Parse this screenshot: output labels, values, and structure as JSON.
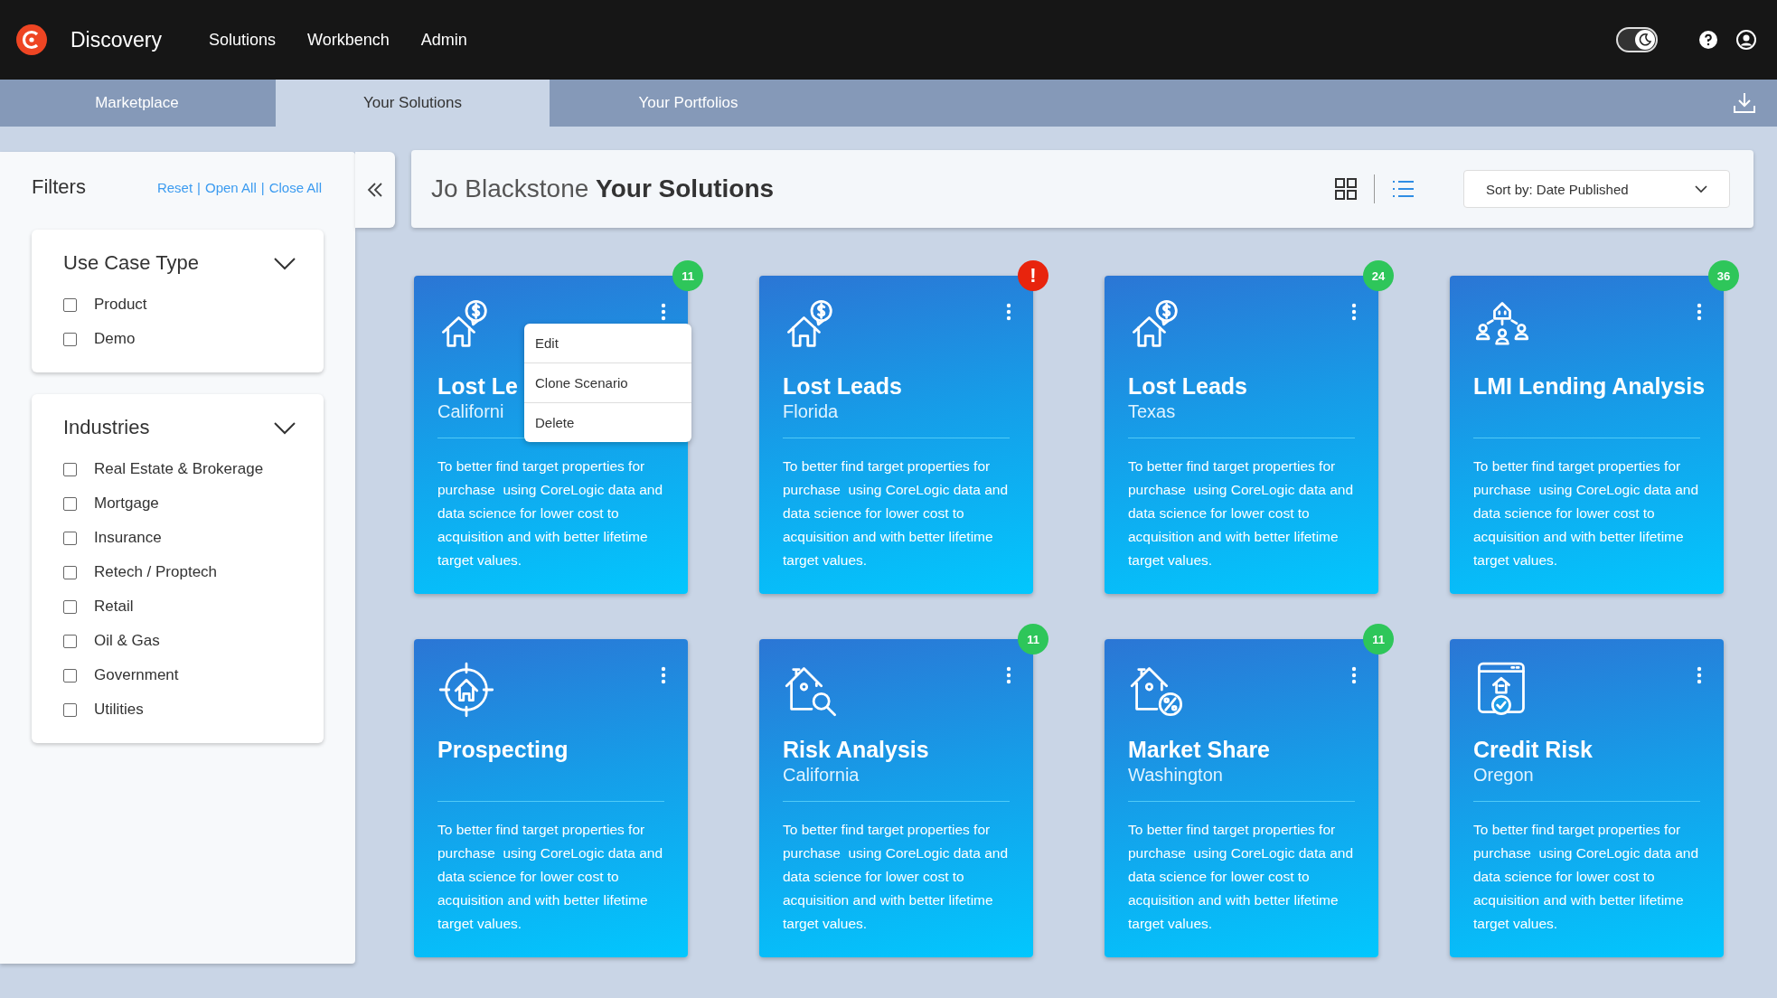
{
  "app": {
    "name": "Discovery"
  },
  "nav": [
    "Solutions",
    "Workbench",
    "Admin"
  ],
  "dark_mode_toggle": {
    "on": true
  },
  "tabs": [
    {
      "label": "Marketplace",
      "selected": false
    },
    {
      "label": "Your Solutions",
      "selected": true
    },
    {
      "label": "Your Portfolios",
      "selected": false
    }
  ],
  "filters": {
    "title": "Filters",
    "actions": [
      "Reset",
      "Open All",
      "Close All"
    ],
    "separator": "|",
    "sections": [
      {
        "title": "Use Case Type",
        "expanded": true,
        "options": [
          {
            "label": "Product",
            "checked": false
          },
          {
            "label": "Demo",
            "checked": false
          }
        ]
      },
      {
        "title": "Industries",
        "expanded": true,
        "options": [
          {
            "label": "Real Estate & Brokerage",
            "checked": false
          },
          {
            "label": "Mortgage",
            "checked": false
          },
          {
            "label": "Insurance",
            "checked": false
          },
          {
            "label": "Retech / Proptech",
            "checked": false
          },
          {
            "label": "Retail",
            "checked": false
          },
          {
            "label": "Oil & Gas",
            "checked": false
          },
          {
            "label": "Government",
            "checked": false
          },
          {
            "label": "Utilities",
            "checked": false
          }
        ]
      }
    ]
  },
  "header": {
    "owner": "Jo Blackstone",
    "title": "Your Solutions",
    "sort": {
      "value": "Sort by: Date Published"
    }
  },
  "cards": [
    {
      "kind": "house-dollar",
      "title": "Lost Le",
      "subtitle": "Californi",
      "description": "To better find target properties for purchase  using CoreLogic data and data science for lower cost to acquisition and with better lifetime target values.",
      "badge": {
        "kind": "count",
        "text": "11"
      },
      "menu": [
        "Edit",
        "Clone Scenario",
        "Delete"
      ]
    },
    {
      "kind": "house-dollar",
      "title": "Lost Leads",
      "subtitle": "Florida",
      "description": "To better find target properties for purchase  using CoreLogic data and data science for lower cost to acquisition and with better lifetime target values.",
      "badge": {
        "kind": "alert",
        "text": "!"
      }
    },
    {
      "kind": "house-dollar",
      "title": "Lost Leads",
      "subtitle": "Texas",
      "description": "To better find target properties for purchase  using CoreLogic data and data science for lower cost to acquisition and with better lifetime target values.",
      "badge": {
        "kind": "count",
        "text": "24"
      }
    },
    {
      "kind": "network",
      "title": "LMI Lending Analysis",
      "description": "To better find target properties for purchase  using CoreLogic data and data science for lower cost to acquisition and with better lifetime target values.",
      "badge": {
        "kind": "count",
        "text": "36"
      }
    },
    {
      "kind": "target",
      "title": "Prospecting",
      "description": "To better find target properties for purchase  using CoreLogic data and data science for lower cost to acquisition and with better lifetime target values."
    },
    {
      "kind": "house-search",
      "title": "Risk Analysis",
      "subtitle": "California",
      "description": "To better find target properties for purchase  using CoreLogic data and data science for lower cost to acquisition and with better lifetime target values.",
      "badge": {
        "kind": "count",
        "text": "11"
      }
    },
    {
      "kind": "house-percent",
      "title": "Market Share",
      "subtitle": "Washington",
      "description": "To better find target properties for purchase  using CoreLogic data and data science for lower cost to acquisition and with better lifetime target values.",
      "badge": {
        "kind": "count",
        "text": "11"
      }
    },
    {
      "kind": "browser-check",
      "title": "Credit Risk",
      "subtitle": "Oregon",
      "description": "To better find target properties for purchase  using CoreLogic data and data science for lower cost to acquisition and with better lifetime target values."
    }
  ]
}
